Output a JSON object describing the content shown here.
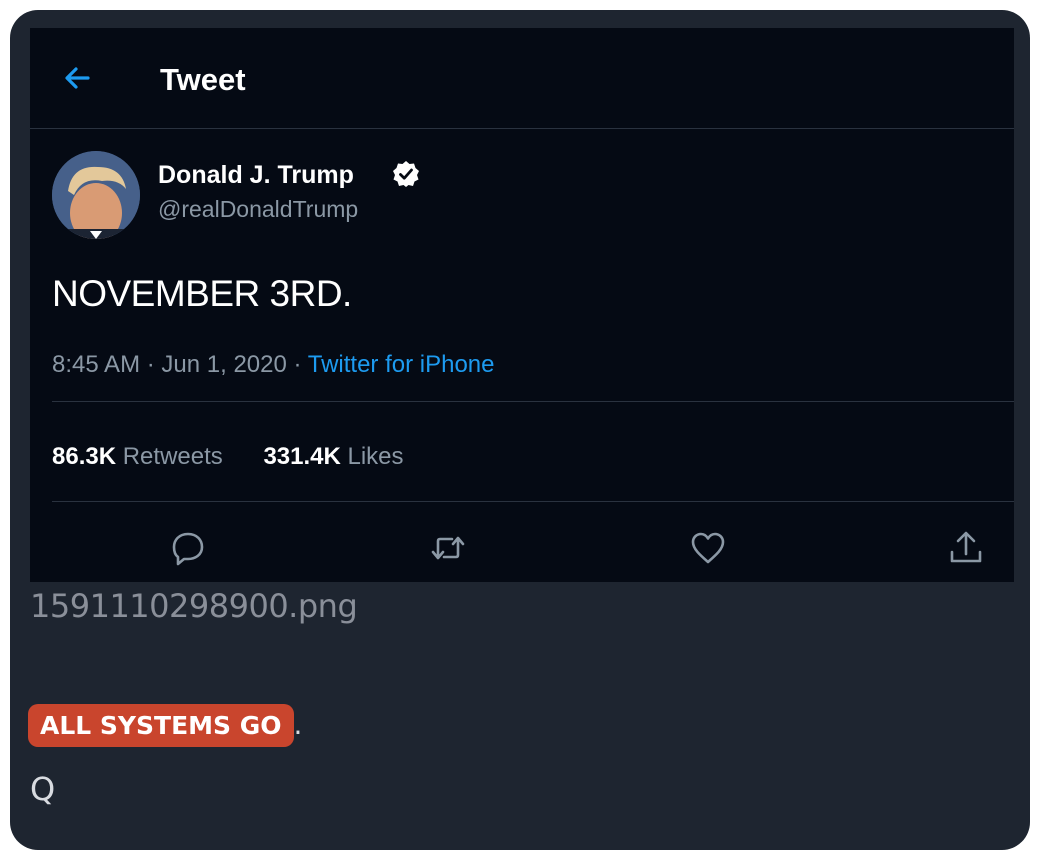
{
  "header": {
    "title": "Tweet",
    "back_icon": "arrow-left-icon"
  },
  "author": {
    "name": "Donald J. Trump",
    "handle": "@realDonaldTrump",
    "verified_icon": "verified-badge-icon"
  },
  "tweet": {
    "text": "NOVEMBER 3RD.",
    "time": "8:45 AM",
    "date": "Jun 1, 2020",
    "source": "Twitter for iPhone",
    "separator": "·"
  },
  "stats": {
    "retweets_count": "86.3K",
    "retweets_label": "Retweets",
    "likes_count": "331.4K",
    "likes_label": "Likes"
  },
  "actions": [
    "reply-icon",
    "retweet-icon",
    "like-icon",
    "share-icon"
  ],
  "post": {
    "filename": "1591110298900.png",
    "badge": "ALL SYSTEMS GO",
    "badge_suffix": ".",
    "signature": "Q"
  },
  "colors": {
    "tweet_background": "#050a14",
    "post_background": "#1e2530",
    "accent_blue": "#1d9bf0",
    "badge_red": "#c9452d",
    "muted_text": "#8b98a5"
  }
}
